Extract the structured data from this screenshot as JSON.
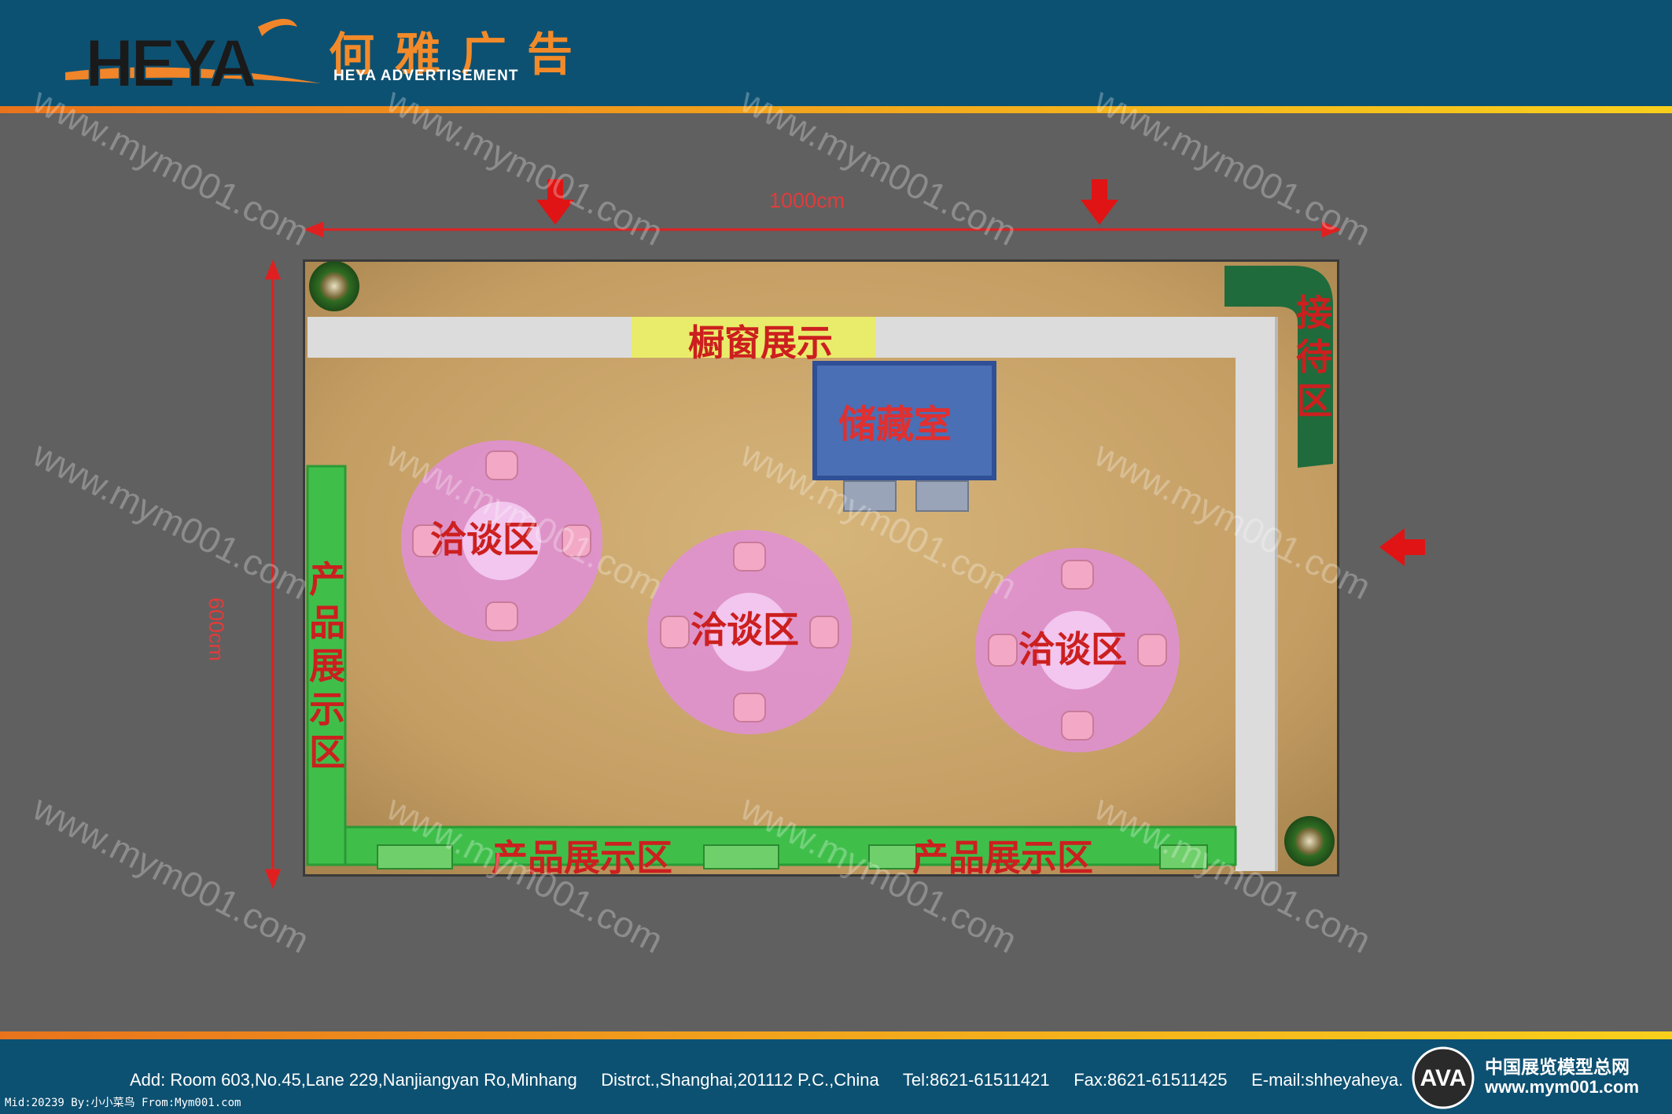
{
  "header": {
    "logo_text": "HEYA",
    "company_cn": "何雅广告",
    "company_en": "HEYA ADVERTISEMENT"
  },
  "plan": {
    "width_label": "1000cm",
    "depth_label": "600cm",
    "zones": {
      "window_display": "橱窗展示",
      "storage": "储藏室",
      "reception": "接\n待\n区",
      "negotiation_1": "洽谈区",
      "negotiation_2": "洽谈区",
      "negotiation_3": "洽谈区",
      "product_left": "产\n品\n展\n示\n区",
      "product_bottom_1": "产品展示区",
      "product_bottom_2": "产品展示区"
    }
  },
  "watermark": "www.mym001.com",
  "footer": {
    "address": "Add: Room 603,No.45,Lane 229,Nanjiangyan Ro,Minhang     Distrct.,Shanghai,201112 P.C.,China     Tel:8621-61511421     Fax:8621-61511425     E-mail:shheyaheya.com",
    "mid": "Mid:20239 By:小小菜鸟 From:Mym001.com",
    "site_name": "中国展览模型总网",
    "site_url": "www.mym001.com",
    "site_badge": "AVA"
  },
  "colors": {
    "header_bg": "#0d5172",
    "page_bg": "#606060",
    "floor": "#c9a86e",
    "wall": "#d9d9d9",
    "green_display": "#3fbf4a",
    "storage_blue": "#4a6fb5",
    "table_pink": "#e08fd8",
    "label_red": "#cc1f1f"
  }
}
